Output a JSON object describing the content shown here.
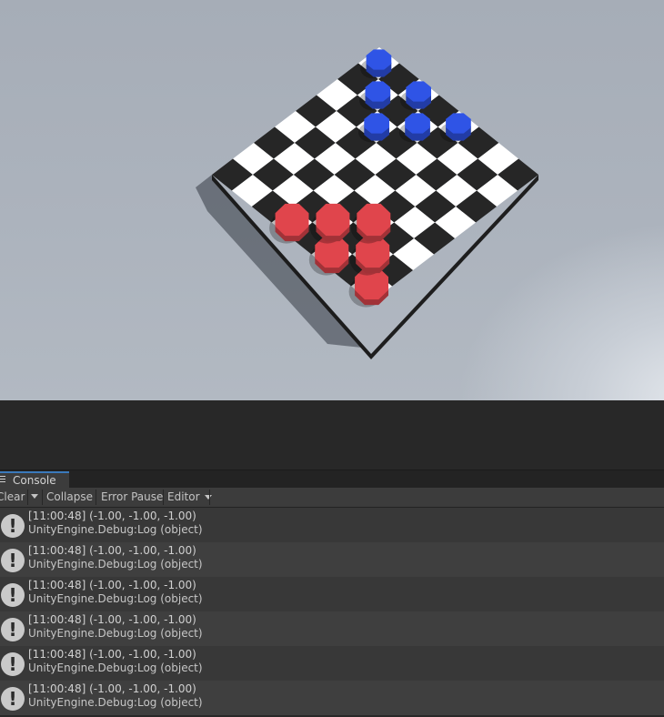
{
  "scene": {
    "board": {
      "size": 8,
      "light_color": "#ffffff",
      "dark_color": "#262626"
    },
    "pieces": {
      "blue": {
        "color": "#2f54e6",
        "count": 6
      },
      "red": {
        "color": "#e0454c",
        "count": 6
      }
    }
  },
  "console": {
    "tab_label": "Console",
    "toolbar": {
      "clear_label": "Clear",
      "collapse_label": "Collapse",
      "error_pause_label": "Error Pause",
      "editor_label": "Editor"
    },
    "entries": [
      {
        "icon": "warning-icon",
        "line1": "[11:00:48] (-1.00, -1.00, -1.00)",
        "line2": "UnityEngine.Debug:Log (object)"
      },
      {
        "icon": "warning-icon",
        "line1": "[11:00:48] (-1.00, -1.00, -1.00)",
        "line2": "UnityEngine.Debug:Log (object)"
      },
      {
        "icon": "warning-icon",
        "line1": "[11:00:48] (-1.00, -1.00, -1.00)",
        "line2": "UnityEngine.Debug:Log (object)"
      },
      {
        "icon": "warning-icon",
        "line1": "[11:00:48] (-1.00, -1.00, -1.00)",
        "line2": "UnityEngine.Debug:Log (object)"
      },
      {
        "icon": "warning-icon",
        "line1": "[11:00:48] (-1.00, -1.00, -1.00)",
        "line2": "UnityEngine.Debug:Log (object)"
      },
      {
        "icon": "warning-icon",
        "line1": "[11:00:48] (-1.00, -1.00, -1.00)",
        "line2": "UnityEngine.Debug:Log (object)"
      }
    ]
  }
}
